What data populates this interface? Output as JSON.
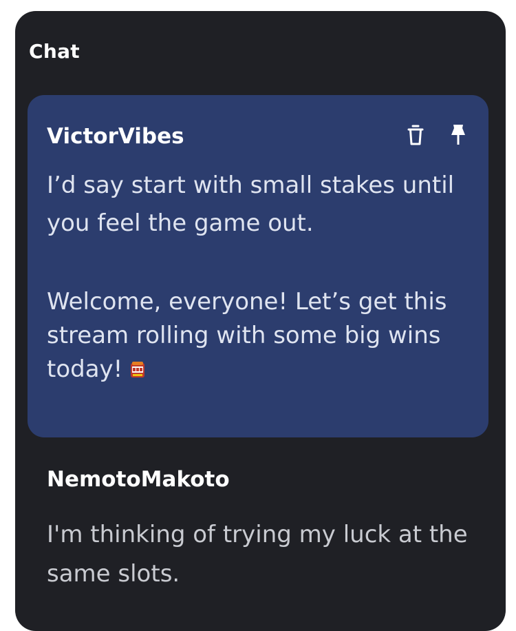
{
  "chat": {
    "title": "Chat",
    "messages": [
      {
        "username": "VictorVibes",
        "highlighted": true,
        "texts": [
          "I’d say start with small stakes until you feel the game out.",
          "Welcome, everyone! Let’s get this stream rolling with some big wins today!"
        ],
        "emoji_icon": "slot-machine-icon",
        "actions": [
          "trash-icon",
          "pin-icon"
        ]
      },
      {
        "username": "NemotoMakoto",
        "highlighted": false,
        "texts": [
          "I'm thinking of trying my luck at the same slots."
        ]
      }
    ]
  },
  "colors": {
    "panel_bg": "#1f2025",
    "highlight_bg": "#2c3d6e",
    "username": "#ffffff",
    "highlight_text": "#dfe4f0",
    "plain_text": "#c9cbd1"
  }
}
